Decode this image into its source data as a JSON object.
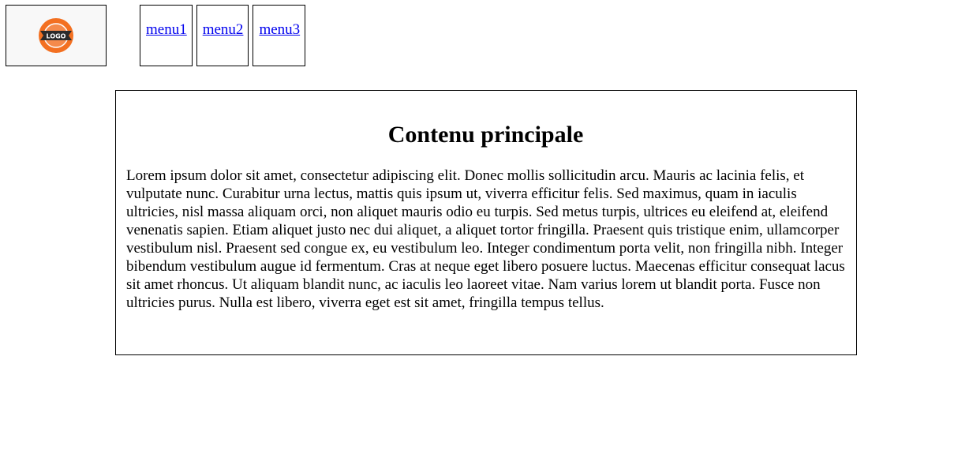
{
  "header": {
    "logo": {
      "text": "LOGO",
      "icon": "logo-badge-icon",
      "colors": {
        "ring": "#f37021",
        "ribbon": "#2b2b2b",
        "inner": "#f58a4b"
      }
    },
    "menu": [
      {
        "label": "menu1"
      },
      {
        "label": "menu2"
      },
      {
        "label": "menu3"
      }
    ]
  },
  "main": {
    "title": "Contenu principale",
    "body": "Lorem ipsum dolor sit amet, consectetur adipiscing elit. Donec mollis sollicitudin arcu. Mauris ac lacinia felis, et vulputate nunc. Curabitur urna lectus, mattis quis ipsum ut, viverra efficitur felis. Sed maximus, quam in iaculis ultricies, nisl massa aliquam orci, non aliquet mauris odio eu turpis. Sed metus turpis, ultrices eu eleifend at, eleifend venenatis sapien. Etiam aliquet justo nec dui aliquet, a aliquet tortor fringilla. Praesent quis tristique enim, ullamcorper vestibulum nisl. Praesent sed congue ex, eu vestibulum leo. Integer condimentum porta velit, non fringilla nibh. Integer bibendum vestibulum augue id fermentum. Cras at neque eget libero posuere luctus. Maecenas efficitur consequat lacus sit amet rhoncus. Ut aliquam blandit nunc, ac iaculis leo laoreet vitae. Nam varius lorem ut blandit porta. Fusce non ultricies purus. Nulla est libero, viverra eget est sit amet, fringilla tempus tellus."
  }
}
